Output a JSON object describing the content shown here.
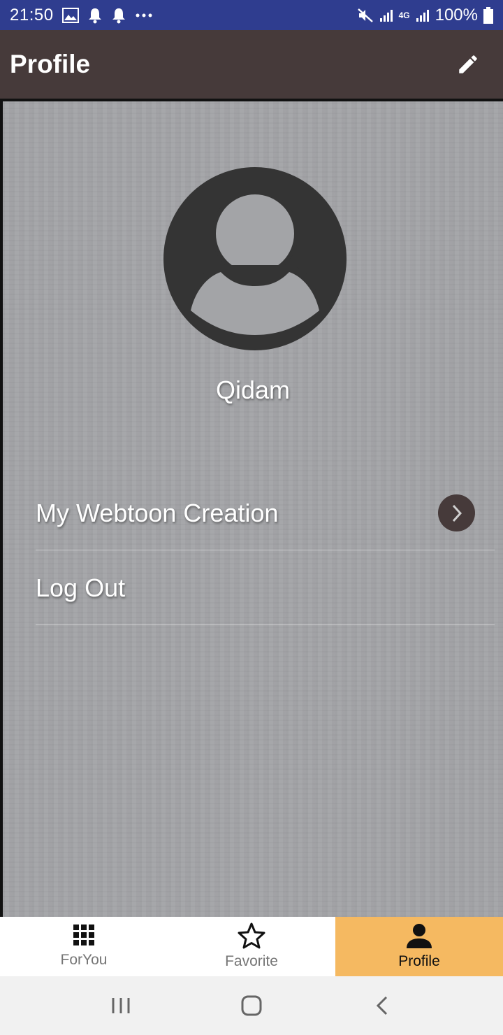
{
  "status_bar": {
    "time": "21:50",
    "network": "4G",
    "battery": "100%",
    "left_icons": [
      "gallery-icon",
      "bell-icon",
      "bell-icon",
      "more-dots-icon"
    ],
    "right_icons": [
      "mute-icon",
      "signal-icon",
      "network-4g-icon",
      "signal-icon",
      "battery-icon"
    ]
  },
  "app_bar": {
    "title": "Profile",
    "action_icon": "edit-pencil-icon"
  },
  "profile": {
    "username": "Qidam",
    "avatar_icon": "user-avatar-icon"
  },
  "menu": [
    {
      "label": "My Webtoon Creation",
      "icon": "chevron-right-icon"
    },
    {
      "label": "Log Out"
    }
  ],
  "bottom_nav": [
    {
      "label": "ForYou",
      "icon": "grid-icon",
      "active": false
    },
    {
      "label": "Favorite",
      "icon": "star-icon",
      "active": false
    },
    {
      "label": "Profile",
      "icon": "person-icon",
      "active": true
    }
  ],
  "system_nav": [
    "recent-apps-icon",
    "home-icon",
    "back-icon"
  ],
  "colors": {
    "status_bar": "#2f3d8f",
    "app_bar": "#463a3a",
    "background": "#a3a4a7",
    "active_tab": "#f5b961",
    "avatar": "#343434"
  }
}
